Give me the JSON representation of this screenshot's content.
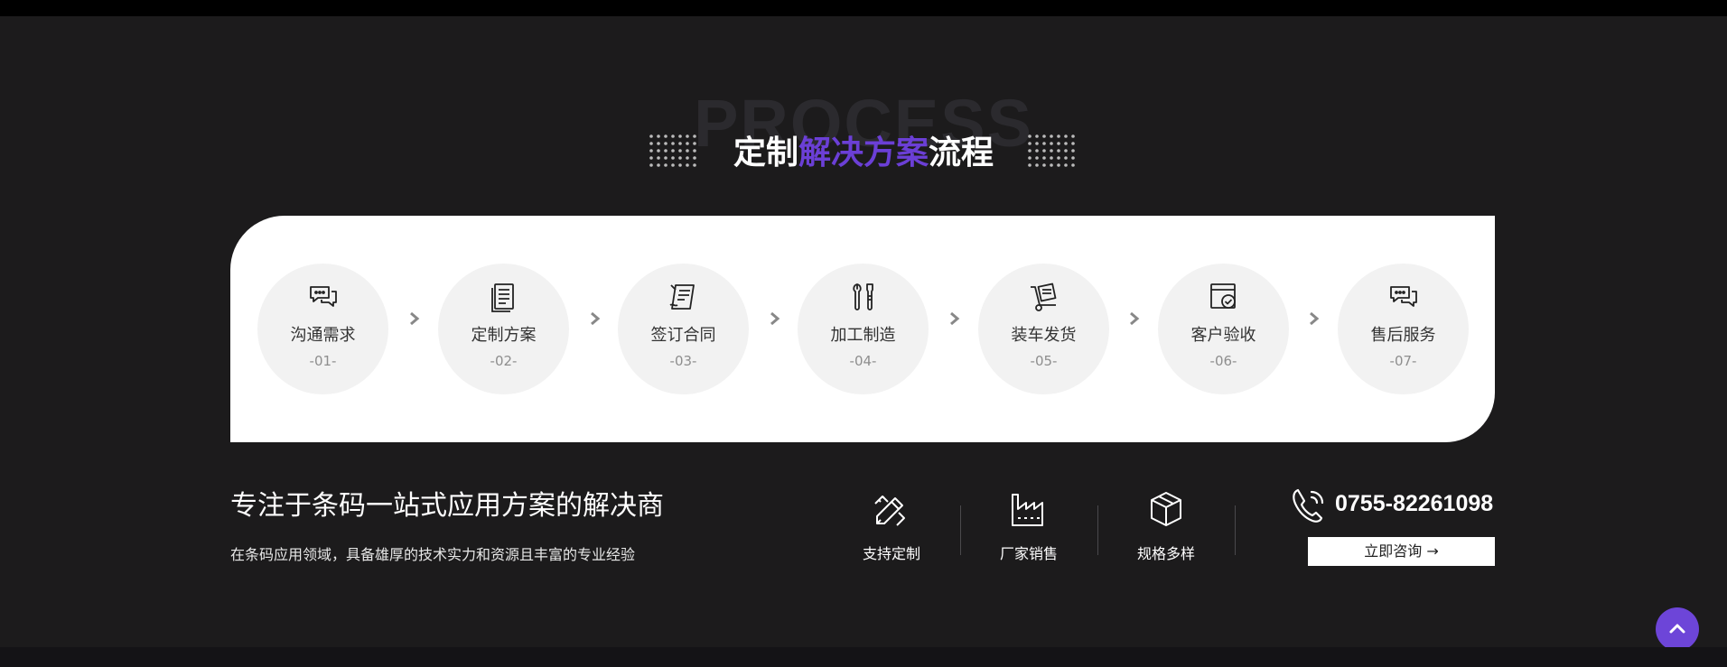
{
  "section": {
    "bg_word": "PROCESS",
    "title_pre": "定制",
    "title_accent": "解决方案",
    "title_post": "流程",
    "accent_color": "#6b3fd6"
  },
  "steps": [
    {
      "label": "沟通需求",
      "num": "-01-",
      "icon": "chat-bubbles-icon"
    },
    {
      "label": "定制方案",
      "num": "-02-",
      "icon": "document-list-icon"
    },
    {
      "label": "签订合同",
      "num": "-03-",
      "icon": "contract-sign-icon"
    },
    {
      "label": "加工制造",
      "num": "-04-",
      "icon": "tools-icon"
    },
    {
      "label": "装车发货",
      "num": "-05-",
      "icon": "hand-truck-icon"
    },
    {
      "label": "客户验收",
      "num": "-06-",
      "icon": "checkbox-window-icon"
    },
    {
      "label": "售后服务",
      "num": "-07-",
      "icon": "chat-bubbles-icon"
    }
  ],
  "info": {
    "headline": "专注于条码一站式应用方案的解决商",
    "subline": "在条码应用领域，具备雄厚的技术实力和资源且丰富的专业经验"
  },
  "features": [
    {
      "label": "支持定制",
      "icon": "pencil-ruler-icon"
    },
    {
      "label": "厂家销售",
      "icon": "factory-icon"
    },
    {
      "label": "规格多样",
      "icon": "box-icon"
    }
  ],
  "contact": {
    "phone": "0755-82261098",
    "button": "立即咨询 →"
  }
}
